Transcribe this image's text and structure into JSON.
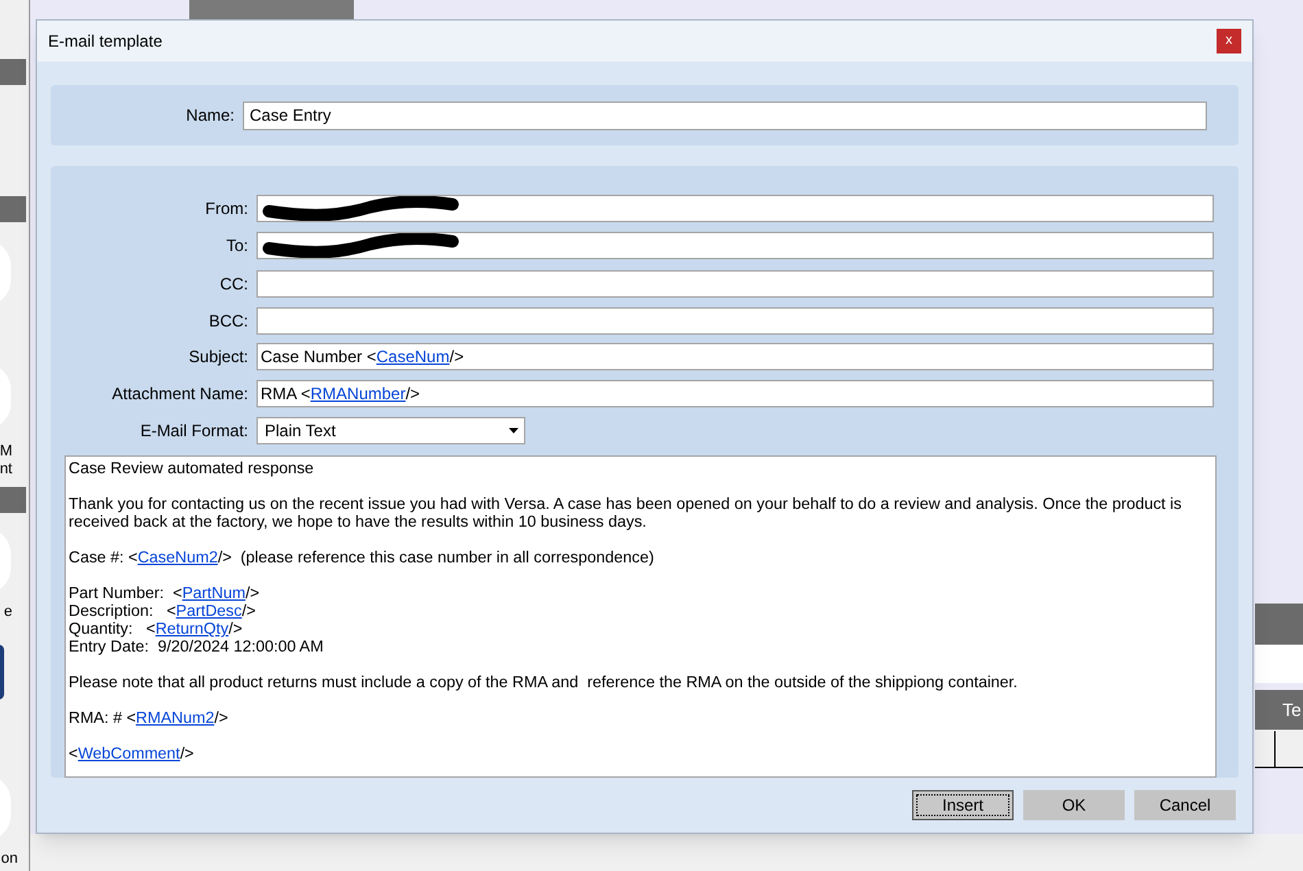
{
  "background": {
    "side_labels": [
      {
        "text": "M",
        "kind": "upper"
      },
      {
        "text": "nt",
        "kind": "upper"
      },
      {
        "text": "e",
        "kind": "middle"
      },
      {
        "text": "on",
        "kind": "lower"
      }
    ],
    "column_header": "Te"
  },
  "window": {
    "title": "E-mail template",
    "close": "x"
  },
  "name_field": {
    "label": "Name:",
    "value": "Case Entry"
  },
  "fields": [
    {
      "label": "From:",
      "kind": "redacted"
    },
    {
      "label": "To:",
      "kind": "redacted"
    },
    {
      "label": "CC:",
      "kind": "text"
    },
    {
      "label": "BCC:",
      "kind": "text"
    },
    {
      "label": "Subject:",
      "kind": "text",
      "value": [
        {
          "text": "Case Number <",
          "link": false
        },
        {
          "text": "CaseNum",
          "link": true
        },
        {
          "text": "/>",
          "link": false
        }
      ]
    },
    {
      "label": "Attachment Name:",
      "kind": "text",
      "value": [
        {
          "text": "RMA <",
          "link": false
        },
        {
          "text": "RMANumber",
          "link": true
        },
        {
          "text": "/>",
          "link": false
        }
      ]
    },
    {
      "label": "E-Mail Format:",
      "kind": "dropdown",
      "value": [
        {
          "text": "Plain Text",
          "link": false
        }
      ]
    }
  ],
  "body": [
    [
      [
        {
          "text": "Case Review automated response",
          "link": false
        }
      ]
    ],
    [
      [
        {
          "text": "Thank you for contacting us on the recent issue you had with Versa. A case has been opened on your behalf to do a review and analysis. Once the product is received back at the factory, we hope to have the results within 10 business days.",
          "link": false
        }
      ]
    ],
    [
      [
        {
          "text": "Case #: <",
          "link": false
        },
        {
          "text": "CaseNum2",
          "link": true
        },
        {
          "text": "/>  (please reference this case number in all correspondence)",
          "link": false
        }
      ]
    ],
    [
      [
        {
          "text": "Part Number:  <",
          "link": false
        },
        {
          "text": "PartNum",
          "link": true
        },
        {
          "text": "/>",
          "link": false
        }
      ],
      [
        {
          "text": "Description:   <",
          "link": false
        },
        {
          "text": "PartDesc",
          "link": true
        },
        {
          "text": "/>",
          "link": false
        }
      ],
      [
        {
          "text": "Quantity:   <",
          "link": false
        },
        {
          "text": "ReturnQty",
          "link": true
        },
        {
          "text": "/>",
          "link": false
        }
      ],
      [
        {
          "text": "Entry Date:  9/20/2024 12:00:00 AM",
          "link": false
        }
      ]
    ],
    [
      [
        {
          "text": "Please note that all product returns must include a copy of the RMA and  reference the RMA on the outside of the shippiong container.",
          "link": false
        }
      ]
    ],
    [
      [
        {
          "text": "RMA: # <",
          "link": false
        },
        {
          "text": "RMANum2",
          "link": true
        },
        {
          "text": "/>",
          "link": false
        }
      ]
    ],
    [
      [
        {
          "text": "<",
          "link": false
        },
        {
          "text": "WebComment",
          "link": true
        },
        {
          "text": "/>",
          "link": false
        }
      ]
    ]
  ],
  "buttons": [
    {
      "label": "Insert",
      "focused": true
    },
    {
      "label": "OK",
      "focused": false
    },
    {
      "label": "Cancel",
      "focused": false
    }
  ]
}
